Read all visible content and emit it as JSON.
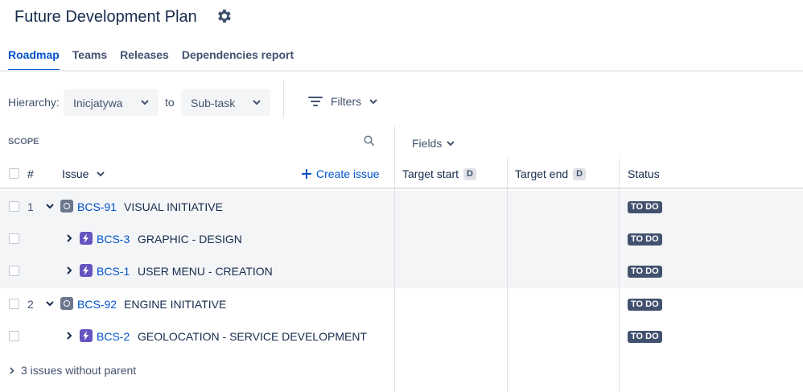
{
  "page": {
    "title": "Future Development Plan"
  },
  "tabs": [
    {
      "label": "Roadmap",
      "active": true
    },
    {
      "label": "Teams"
    },
    {
      "label": "Releases"
    },
    {
      "label": "Dependencies report"
    }
  ],
  "toolbar": {
    "hierarchy_label": "Hierarchy:",
    "from_value": "Inicjatywa",
    "to_label": "to",
    "to_value": "Sub-task",
    "filters_label": "Filters"
  },
  "scope": {
    "label": "SCOPE"
  },
  "fields": {
    "label": "Fields"
  },
  "columns": {
    "number": "#",
    "issue": "Issue",
    "create_issue": "Create issue",
    "target_start": "Target start",
    "target_end": "Target end",
    "date_badge": "D",
    "status": "Status"
  },
  "rows": [
    {
      "num": "1",
      "key": "BCS-91",
      "summary": "VISUAL INITIATIVE",
      "status": "TO DO",
      "type": "initiative",
      "level": 0,
      "expanded": true
    },
    {
      "num": "",
      "key": "BCS-3",
      "summary": "GRAPHIC - DESIGN",
      "status": "TO DO",
      "type": "epic",
      "level": 1,
      "expanded": false
    },
    {
      "num": "",
      "key": "BCS-1",
      "summary": "USER MENU - CREATION",
      "status": "TO DO",
      "type": "epic",
      "level": 1,
      "expanded": false
    },
    {
      "num": "2",
      "key": "BCS-92",
      "summary": "ENGINE INITIATIVE",
      "status": "TO DO",
      "type": "initiative",
      "level": 0,
      "expanded": true
    },
    {
      "num": "",
      "key": "BCS-2",
      "summary": "GEOLOCATION - SERVICE DEVELOPMENT",
      "status": "TO DO",
      "type": "epic",
      "level": 1,
      "expanded": false
    }
  ],
  "footer": {
    "without_parent": "3 issues without parent"
  },
  "colors": {
    "accent": "#0052cc",
    "status_bg": "#42526e",
    "epic": "#6554c0",
    "initiative": "#6b778c"
  }
}
